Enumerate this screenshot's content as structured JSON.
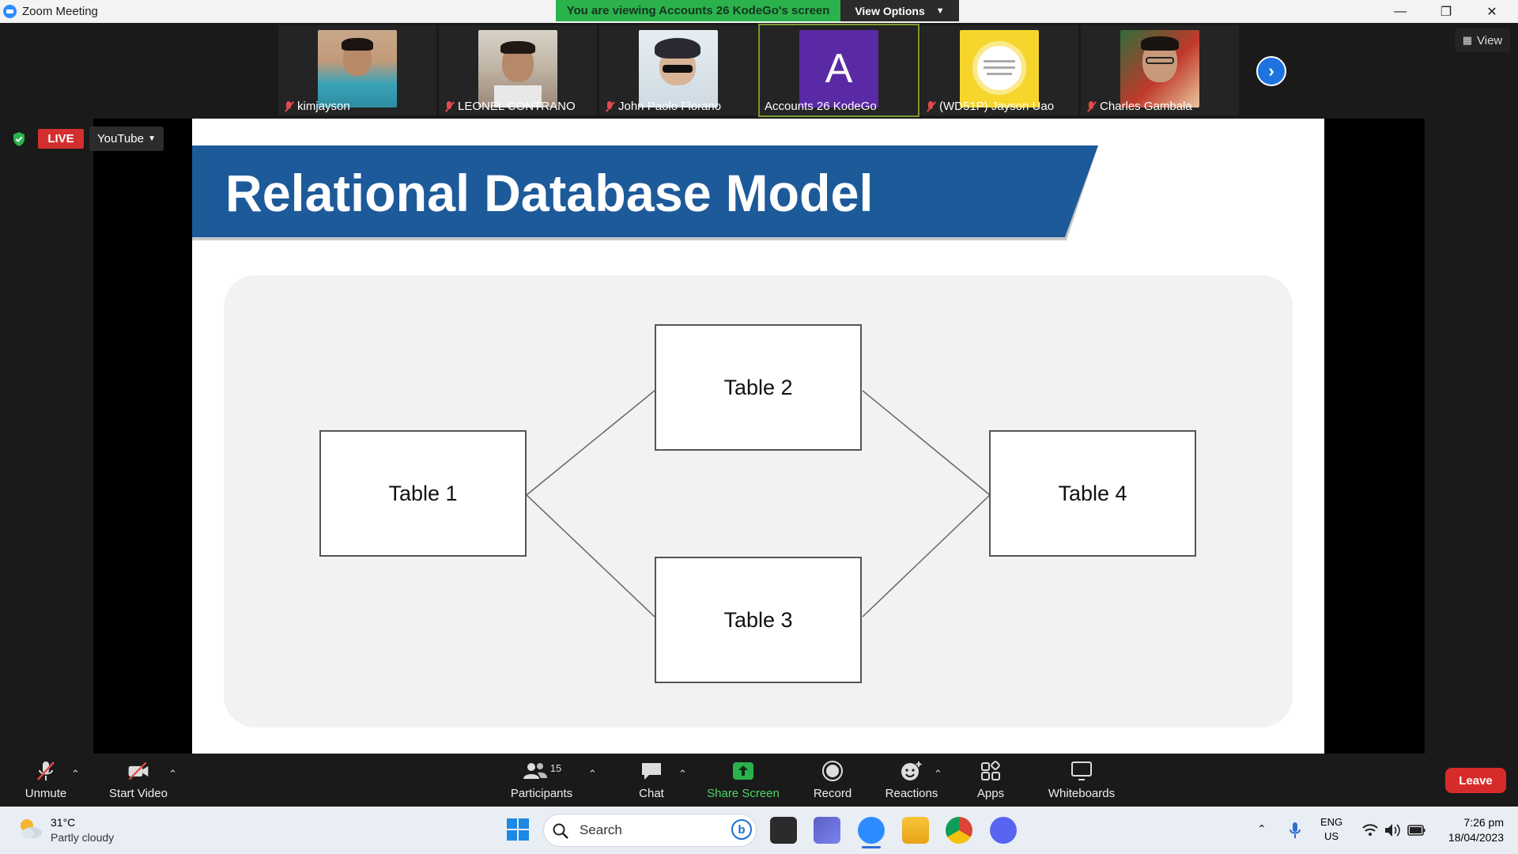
{
  "window": {
    "title": "Zoom Meeting",
    "banner": "You are viewing Accounts 26 KodeGo's screen",
    "view_options": "View Options",
    "controls": [
      "minimize",
      "restore",
      "close"
    ]
  },
  "participants": [
    {
      "name": "kimjayson",
      "muted": true,
      "color": "#7a8a8f"
    },
    {
      "name": "LEONEL CONTRANO",
      "muted": true,
      "color": "#8c7e72"
    },
    {
      "name": "John Paolo Florano",
      "muted": true,
      "color": "#6a7b8c"
    },
    {
      "name": "Accounts 26 KodeGo",
      "muted": false,
      "avatar_letter": "A",
      "color": "#5a2aa6"
    },
    {
      "name": "(WD51P) Jayson Uao",
      "muted": true,
      "color": "#f6d62c"
    },
    {
      "name": "Charles Gambala",
      "muted": true,
      "color": "#9a3a3a"
    }
  ],
  "view_button": "View",
  "live": {
    "badge": "LIVE",
    "platform": "YouTube"
  },
  "slide": {
    "title": "Relational Database Model",
    "banner_color": "#1d5a9a",
    "tables": [
      "Table 1",
      "Table 2",
      "Table 3",
      "Table 4"
    ]
  },
  "toolbar": {
    "unmute": "Unmute",
    "start_video": "Start Video",
    "participants": "Participants",
    "participants_count": "15",
    "chat": "Chat",
    "share_screen": "Share Screen",
    "record": "Record",
    "reactions": "Reactions",
    "apps": "Apps",
    "whiteboards": "Whiteboards",
    "leave": "Leave"
  },
  "taskbar": {
    "weather_temp": "31°C",
    "weather_desc": "Partly cloudy",
    "search_placeholder": "Search",
    "lang_line1": "ENG",
    "lang_line2": "US",
    "time": "7:26 pm",
    "date": "18/04/2023"
  }
}
